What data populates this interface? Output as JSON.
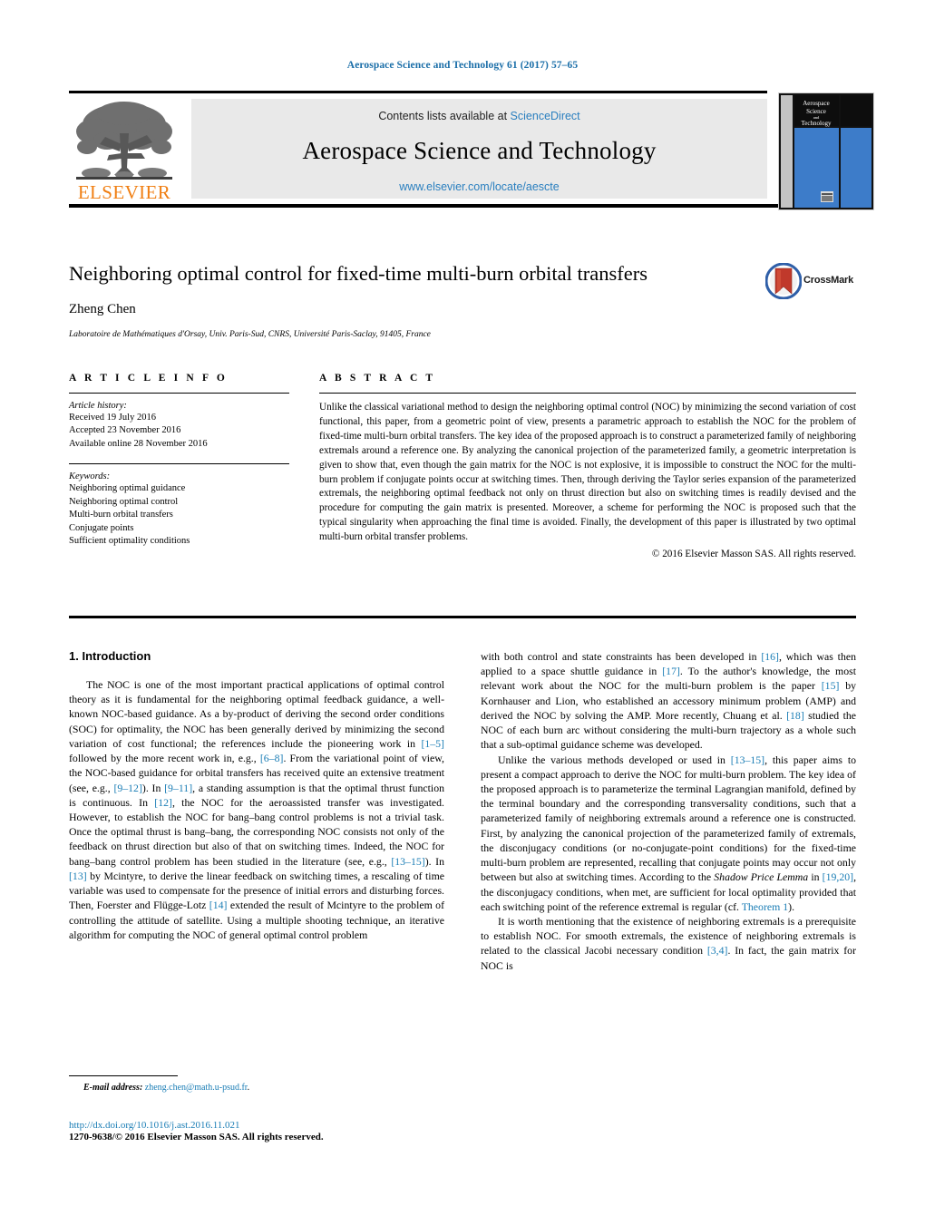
{
  "running_head": "Aerospace Science and Technology 61 (2017) 57–65",
  "masthead": {
    "contents_prefix": "Contents lists available at",
    "sciencedirect": "ScienceDirect",
    "journal_title": "Aerospace Science and Technology",
    "journal_url": "www.elsevier.com/locate/aescte",
    "publisher_wordmark": "ELSEVIER",
    "cover": {
      "line1": "Aerospace",
      "line2": "Science",
      "line3": "and",
      "line4": "Technology"
    },
    "colors": {
      "link_blue": "#2a7fbf",
      "elsevier_orange": "#f07f13",
      "banner_gray": "#e9e9e9",
      "cover_blue": "#3d7cc9"
    }
  },
  "title_block": {
    "title": "Neighboring optimal control for fixed-time multi-burn orbital transfers",
    "crossmark_label": "CrossMark",
    "author": "Zheng Chen",
    "affiliation": "Laboratoire de Mathématiques d'Orsay, Univ. Paris-Sud, CNRS, Université Paris-Saclay, 91405, France"
  },
  "article_info": {
    "heading": "A R T I C L E   I N F O",
    "history_label": "Article history:",
    "history": [
      "Received 19 July 2016",
      "Accepted 23 November 2016",
      "Available online 28 November 2016"
    ],
    "keywords_label": "Keywords:",
    "keywords": [
      "Neighboring optimal guidance",
      "Neighboring optimal control",
      "Multi-burn orbital transfers",
      "Conjugate points",
      "Sufficient optimality conditions"
    ]
  },
  "abstract": {
    "heading": "A B S T R A C T",
    "text": "Unlike the classical variational method to design the neighboring optimal control (NOC) by minimizing the second variation of cost functional, this paper, from a geometric point of view, presents a parametric approach to establish the NOC for the problem of fixed-time multi-burn orbital transfers. The key idea of the proposed approach is to construct a parameterized family of neighboring extremals around a reference one. By analyzing the canonical projection of the parameterized family, a geometric interpretation is given to show that, even though the gain matrix for the NOC is not explosive, it is impossible to construct the NOC for the multi-burn problem if conjugate points occur at switching times. Then, through deriving the Taylor series expansion of the parameterized extremals, the neighboring optimal feedback not only on thrust direction but also on switching times is readily devised and the procedure for computing the gain matrix is presented. Moreover, a scheme for performing the NOC is proposed such that the typical singularity when approaching the final time is avoided. Finally, the development of this paper is illustrated by two optimal multi-burn orbital transfer problems.",
    "copyright": "© 2016 Elsevier Masson SAS. All rights reserved."
  },
  "body": {
    "section_title": "1. Introduction",
    "left": {
      "p1_a": "The NOC is one of the most important practical applications of optimal control theory as it is fundamental for the neighboring optimal feedback guidance, a well-known NOC-based guidance. As a by-product of deriving the second order conditions (SOC) for optimality, the NOC has been generally derived by minimizing the second variation of cost functional; the references include the pioneering work in ",
      "p1_r1": "[1–5]",
      "p1_b": " followed by the more recent work in, e.g., ",
      "p1_r2": "[6–8]",
      "p1_c": ". From the variational point of view, the NOC-based guidance for orbital transfers has received quite an extensive treatment (see, e.g., ",
      "p1_r3": "[9–12]",
      "p1_d": "). In ",
      "p1_r4": "[9–11]",
      "p1_e": ", a standing assumption is that the optimal thrust function is continuous. In ",
      "p1_r5": "[12]",
      "p1_f": ", the NOC for the aeroassisted transfer was investigated. However, to establish the NOC for bang–bang control problems is not a trivial task. Once the optimal thrust is bang–bang, the corresponding NOC consists not only of the feedback on thrust direction but also of that on switching times. Indeed, the NOC for bang–bang control problem has been studied in the literature (see, e.g., ",
      "p1_r6": "[13–15]",
      "p1_g": "). In ",
      "p1_r7": "[13]",
      "p1_h": " by Mcintyre, to derive the linear feedback on switching times, a rescaling of time variable was used to compensate for the presence of initial errors and disturbing forces. Then, Foerster and Flügge-Lotz ",
      "p1_r8": "[14]",
      "p1_i": " extended the result of Mcintyre to the problem of controlling the attitude of satellite. Using a multiple shooting technique, an iterative algorithm for computing the NOC of general optimal control problem"
    },
    "right": {
      "p1_a": "with both control and state constraints has been developed in ",
      "p1_r1": "[16]",
      "p1_b": ", which was then applied to a space shuttle guidance in ",
      "p1_r2": "[17]",
      "p1_c": ". To the author's knowledge, the most relevant work about the NOC for the multi-burn problem is the paper ",
      "p1_r3": "[15]",
      "p1_d": " by Kornhauser and Lion, who established an accessory minimum problem (AMP) and derived the NOC by solving the AMP. More recently, Chuang et al. ",
      "p1_r4": "[18]",
      "p1_e": " studied the NOC of each burn arc without considering the multi-burn trajectory as a whole such that a sub-optimal guidance scheme was developed.",
      "p2_a": "Unlike the various methods developed or used in ",
      "p2_r1": "[13–15]",
      "p2_b": ", this paper aims to present a compact approach to derive the NOC for multi-burn problem. The key idea of the proposed approach is to parameterize the terminal Lagrangian manifold, defined by the terminal boundary and the corresponding transversality conditions, such that a parameterized family of neighboring extremals around a reference one is constructed. First, by analyzing the canonical projection of the parameterized family of extremals, the disconjugacy conditions (or no-conjugate-point conditions) for the fixed-time multi-burn problem are represented, recalling that conjugate points may occur not only between but also at switching times. According to the ",
      "p2_i1": "Shadow Price Lemma",
      "p2_c": " in ",
      "p2_r2": "[19,20]",
      "p2_d": ", the disconjugacy conditions, when met, are sufficient for local optimality provided that each switching point of the reference extremal is regular (cf. ",
      "p2_r3": "Theorem 1",
      "p2_e": ").",
      "p3_a": "It is worth mentioning that the existence of neighboring extremals is a prerequisite to establish NOC. For smooth extremals, the existence of neighboring extremals is related to the classical Jacobi necessary condition ",
      "p3_r1": "[3,4]",
      "p3_b": ". In fact, the gain matrix for NOC is"
    }
  },
  "footnote": {
    "label": "E-mail address:",
    "email": "zheng.chen@math.u-psud.fr",
    "trailing": "."
  },
  "footer": {
    "doi": "http://dx.doi.org/10.1016/j.ast.2016.11.021",
    "issn_line": "1270-9638/© 2016 Elsevier Masson SAS. All rights reserved."
  }
}
